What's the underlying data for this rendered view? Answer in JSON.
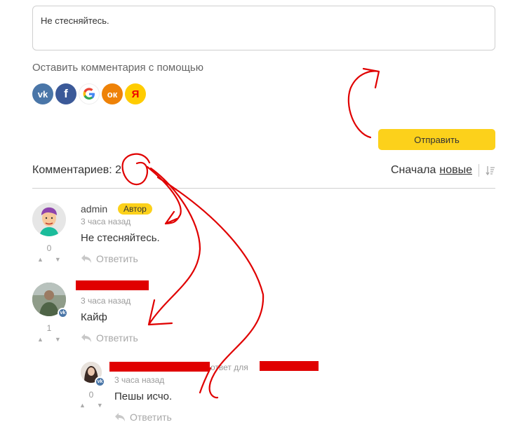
{
  "comment_box": {
    "text": "Не стесняйтесь."
  },
  "login": {
    "label": "Оставить комментария с помощью",
    "providers": [
      {
        "name": "vk-icon",
        "glyph": "vk"
      },
      {
        "name": "facebook-icon",
        "glyph": "f"
      },
      {
        "name": "google-icon",
        "glyph": "G"
      },
      {
        "name": "odnoklassniki-icon",
        "glyph": "ок"
      },
      {
        "name": "yandex-icon",
        "glyph": "Я"
      }
    ]
  },
  "submit_label": "Отправить",
  "header": {
    "count_label": "Комментариев: 2",
    "sort_prefix": "Сначала",
    "sort_value": "новые"
  },
  "comments": [
    {
      "author": "admin",
      "badge": "Автор",
      "time": "3 часа назад",
      "text": "Не стесняйтесь.",
      "votes": "0",
      "reply": "Ответить"
    },
    {
      "author": "",
      "time": "3 часа назад",
      "text": "Кайф",
      "votes": "1",
      "reply": "Ответить"
    },
    {
      "author": "",
      "reply_for": "ответ для",
      "time": "3 часа назад",
      "text": "Пешы исчо.",
      "votes": "0",
      "reply": "Ответить"
    }
  ],
  "colors": {
    "accent": "#fcd11b",
    "vk": "#4a76a8",
    "annotation": "#e00000"
  }
}
